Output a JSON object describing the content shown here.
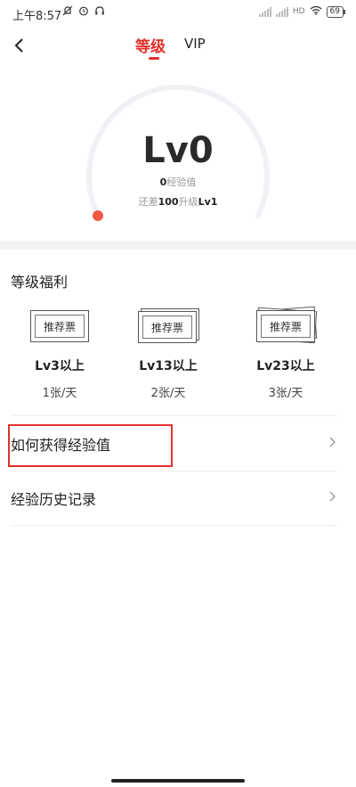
{
  "status_bar": {
    "time": "上午8:57",
    "left_icons": [
      "mute-icon",
      "alarm-icon",
      "headphones-icon"
    ],
    "network": "HD",
    "battery": "69"
  },
  "nav": {
    "tabs": [
      {
        "label": "等级",
        "active": true
      },
      {
        "label": "VIP",
        "active": false
      }
    ]
  },
  "level": {
    "current": "Lv0",
    "exp_value": "0",
    "exp_label": "经验值",
    "need_prefix": "还差",
    "need_value": "100",
    "need_mid": "升级",
    "next_level": "Lv1",
    "progress": 0
  },
  "benefits": {
    "title": "等级福利",
    "items": [
      {
        "ticket_label": "推荐票",
        "level": "Lv3以上",
        "quantity": "1张/天"
      },
      {
        "ticket_label": "推荐票",
        "level": "Lv13以上",
        "quantity": "2张/天"
      },
      {
        "ticket_label": "推荐票",
        "level": "Lv23以上",
        "quantity": "3张/天"
      }
    ]
  },
  "rows": [
    {
      "label": "如何获得经验值"
    },
    {
      "label": "经验历史记录"
    }
  ],
  "colors": {
    "accent": "#e0312d",
    "gauge_track": "#f0f1f5",
    "gauge_dot": "#f05a45"
  }
}
